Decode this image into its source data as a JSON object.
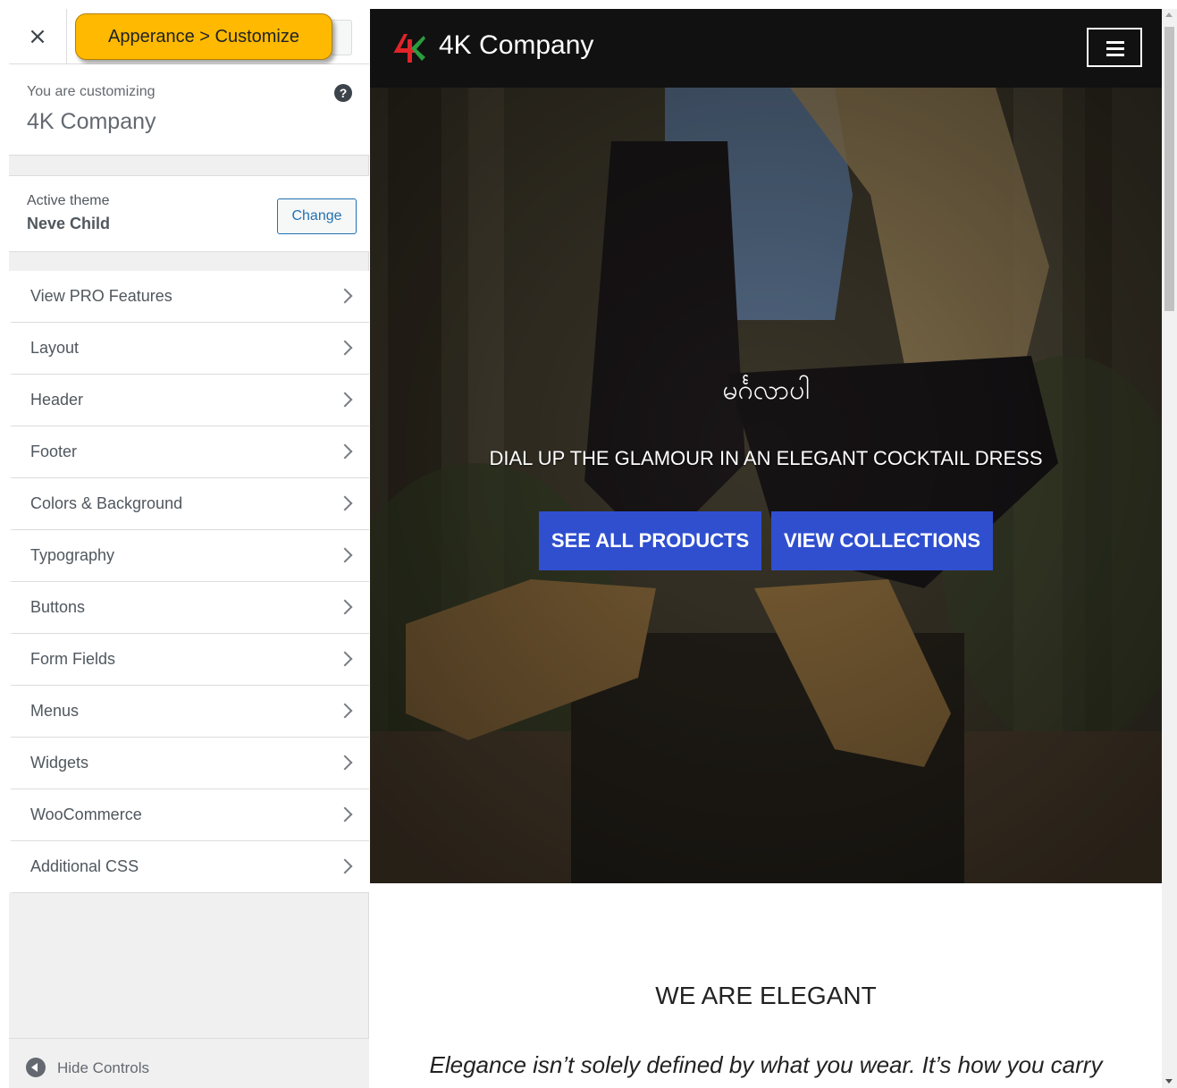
{
  "top_bar": {
    "close_glyph": "×",
    "callout": "Apperance > Customize"
  },
  "customizing": {
    "label": "You are customizing",
    "site_name": "4K Company",
    "help_glyph": "?"
  },
  "theme": {
    "label": "Active theme",
    "name": "Neve Child",
    "change_label": "Change"
  },
  "panels": [
    {
      "label": "View PRO Features"
    },
    {
      "label": "Layout"
    },
    {
      "label": "Header"
    },
    {
      "label": "Footer"
    },
    {
      "label": "Colors & Background"
    },
    {
      "label": "Typography"
    },
    {
      "label": "Buttons"
    },
    {
      "label": "Form Fields"
    },
    {
      "label": "Menus"
    },
    {
      "label": "Widgets"
    },
    {
      "label": "WooCommerce"
    },
    {
      "label": "Additional CSS"
    }
  ],
  "footer": {
    "hide_label": "Hide Controls"
  },
  "preview": {
    "site_title": "4K Company",
    "hero_title": "မင်္ဂလာပါ",
    "hero_subtitle": "DIAL UP THE GLAMOUR IN AN ELEGANT COCKTAIL DRESS",
    "primary_button": "SEE ALL PRODUCTS",
    "secondary_button": "VIEW COLLECTIONS",
    "section_title": "WE ARE ELEGANT",
    "section_text": "Elegance isn’t solely defined by what you wear. It’s how you carry"
  },
  "colors": {
    "accent": "#2271b1",
    "callout": "#ffb900",
    "hero_button": "#2f4fcf",
    "header_bg": "#111111"
  }
}
